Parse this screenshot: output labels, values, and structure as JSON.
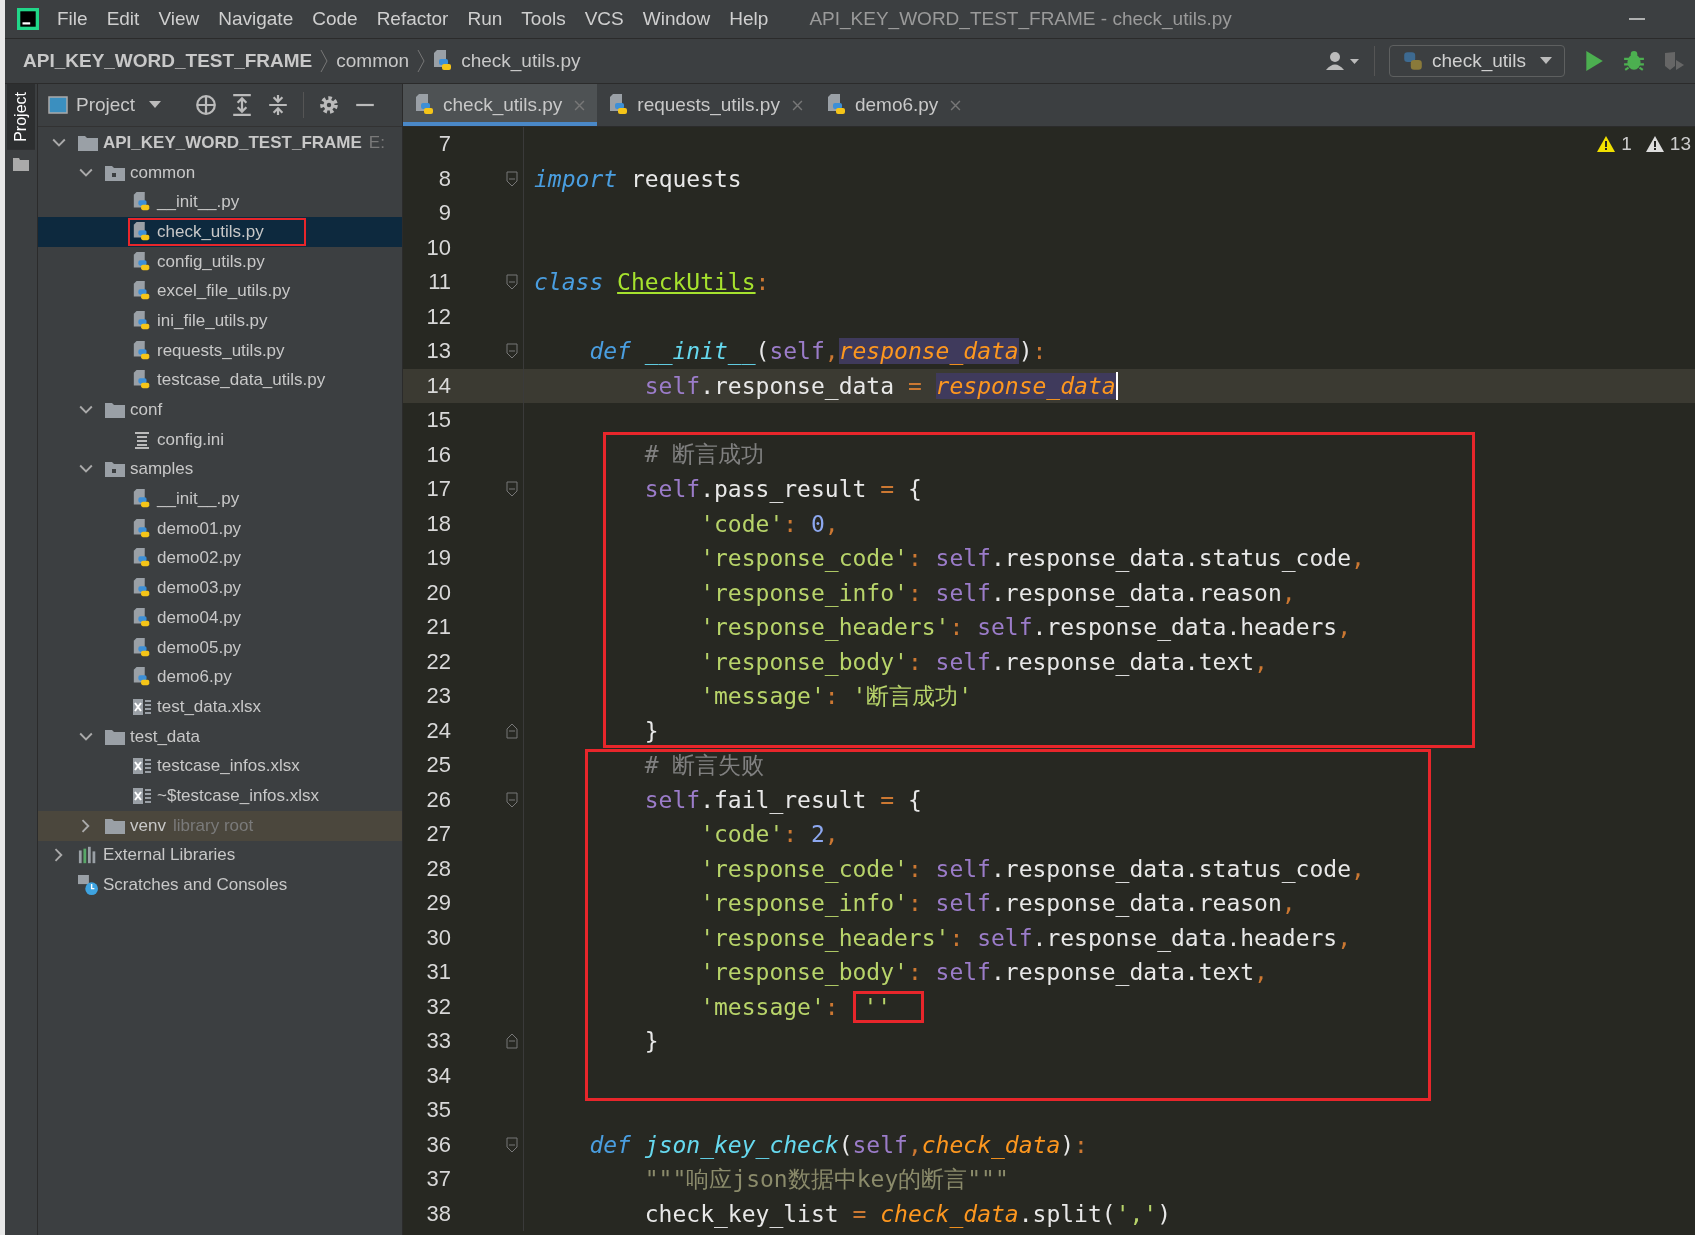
{
  "window": {
    "title": "API_KEY_WORD_TEST_FRAME - check_utils.py"
  },
  "menu": [
    "File",
    "Edit",
    "View",
    "Navigate",
    "Code",
    "Refactor",
    "Run",
    "Tools",
    "VCS",
    "Window",
    "Help"
  ],
  "breadcrumbs": [
    "API_KEY_WORD_TEST_FRAME",
    "common",
    "check_utils.py"
  ],
  "run_config": "check_utils",
  "side_strip": {
    "label": "Project"
  },
  "project_panel": {
    "title": "Project"
  },
  "tree": [
    {
      "label": "API_KEY_WORD_TEST_FRAME",
      "hint": "E:",
      "kind": "project",
      "expanded": true,
      "selected": false,
      "children": [
        {
          "label": "common",
          "kind": "package",
          "expanded": true,
          "selected": false,
          "children": [
            {
              "label": "__init__.py",
              "kind": "py",
              "selected": false
            },
            {
              "label": "check_utils.py",
              "kind": "py",
              "selected": true,
              "framed": true
            },
            {
              "label": "config_utils.py",
              "kind": "py",
              "selected": false
            },
            {
              "label": "excel_file_utils.py",
              "kind": "py",
              "selected": false
            },
            {
              "label": "ini_file_utils.py",
              "kind": "py",
              "selected": false
            },
            {
              "label": "requests_utils.py",
              "kind": "py",
              "selected": false
            },
            {
              "label": "testcase_data_utils.py",
              "kind": "py",
              "selected": false
            }
          ]
        },
        {
          "label": "conf",
          "kind": "folder",
          "expanded": true,
          "selected": false,
          "children": [
            {
              "label": "config.ini",
              "kind": "ini",
              "selected": false
            }
          ]
        },
        {
          "label": "samples",
          "kind": "package",
          "expanded": true,
          "selected": false,
          "children": [
            {
              "label": "__init__.py",
              "kind": "py",
              "selected": false
            },
            {
              "label": "demo01.py",
              "kind": "py",
              "selected": false
            },
            {
              "label": "demo02.py",
              "kind": "py",
              "selected": false
            },
            {
              "label": "demo03.py",
              "kind": "py",
              "selected": false
            },
            {
              "label": "demo04.py",
              "kind": "py",
              "selected": false
            },
            {
              "label": "demo05.py",
              "kind": "py",
              "selected": false
            },
            {
              "label": "demo6.py",
              "kind": "py",
              "selected": false
            },
            {
              "label": "test_data.xlsx",
              "kind": "xlsx",
              "selected": false
            }
          ]
        },
        {
          "label": "test_data",
          "kind": "folder",
          "expanded": true,
          "selected": false,
          "children": [
            {
              "label": "testcase_infos.xlsx",
              "kind": "xlsx",
              "selected": false
            },
            {
              "label": "~$testcase_infos.xlsx",
              "kind": "xlsx",
              "selected": false
            }
          ]
        },
        {
          "label": "venv",
          "hint": "library root",
          "kind": "folder",
          "expanded": false,
          "selected": false,
          "highlighted": true
        }
      ]
    },
    {
      "label": "External Libraries",
      "kind": "libs",
      "expanded": false,
      "selected": false
    },
    {
      "label": "Scratches and Consoles",
      "kind": "scratch",
      "selected": false
    }
  ],
  "tabs": [
    {
      "label": "check_utils.py",
      "selected": true
    },
    {
      "label": "requests_utils.py",
      "selected": false
    },
    {
      "label": "demo6.py",
      "selected": false
    }
  ],
  "inspections": [
    {
      "kind": "warning",
      "count": "1"
    },
    {
      "kind": "weak",
      "count": "13"
    }
  ],
  "code": {
    "sections": [
      {
        "lines": [
          {
            "n": "7"
          },
          {
            "n": "8",
            "fold_open": true,
            "tokens": [
              {
                "kind": "kw",
                "text": "import"
              },
              {
                "kind": "p",
                "text": " requests"
              }
            ]
          },
          {
            "n": "9"
          },
          {
            "n": "10"
          },
          {
            "n": "11",
            "fold_open": true,
            "tokens": [
              {
                "kind": "kw",
                "text": "class "
              },
              {
                "kind": "cls",
                "text": "CheckUtils"
              },
              {
                "kind": "op",
                "text": ":"
              }
            ]
          },
          {
            "n": "12"
          },
          {
            "n": "13",
            "fold_open": true,
            "tokens": [
              {
                "kind": "kw",
                "text": "    def "
              },
              {
                "kind": "fn",
                "text": "__init__"
              },
              {
                "kind": "p",
                "text": "("
              },
              {
                "kind": "self",
                "text": "self"
              },
              {
                "kind": "op",
                "text": ","
              },
              {
                "kind": "param_hl",
                "text": "response_data"
              },
              {
                "kind": "p",
                "text": ")"
              },
              {
                "kind": "op",
                "text": ":"
              }
            ]
          },
          {
            "n": "14",
            "current": true,
            "tokens": [
              {
                "kind": "self",
                "text": "        self"
              },
              {
                "kind": "p",
                "text": ".response_data "
              },
              {
                "kind": "op",
                "text": "= "
              },
              {
                "kind": "param_hl",
                "text": "response_data"
              }
            ]
          },
          {
            "n": "15"
          }
        ]
      },
      {
        "framed": true,
        "lines": [
          {
            "n": "16",
            "tokens": [
              {
                "kind": "cm",
                "text": "        # 断言成功"
              }
            ]
          },
          {
            "n": "17",
            "fold_open": true,
            "tokens": [
              {
                "kind": "self",
                "text": "        self"
              },
              {
                "kind": "p",
                "text": ".pass_result "
              },
              {
                "kind": "op",
                "text": "="
              },
              {
                "kind": "p",
                "text": " {"
              }
            ]
          },
          {
            "n": "18",
            "tokens": [
              {
                "kind": "str",
                "text": "            'code'"
              },
              {
                "kind": "op",
                "text": ":"
              },
              {
                "kind": "num",
                "text": " 0"
              },
              {
                "kind": "op",
                "text": ","
              }
            ]
          },
          {
            "n": "19",
            "tokens": [
              {
                "kind": "str",
                "text": "            'response_code'"
              },
              {
                "kind": "op",
                "text": ":"
              },
              {
                "kind": "self",
                "text": " self"
              },
              {
                "kind": "p",
                "text": ".response_data.status_code"
              },
              {
                "kind": "op",
                "text": ","
              }
            ]
          },
          {
            "n": "20",
            "tokens": [
              {
                "kind": "str",
                "text": "            'response_info'"
              },
              {
                "kind": "op",
                "text": ":"
              },
              {
                "kind": "self",
                "text": " self"
              },
              {
                "kind": "p",
                "text": ".response_data.reason"
              },
              {
                "kind": "op",
                "text": ","
              }
            ]
          },
          {
            "n": "21",
            "tokens": [
              {
                "kind": "str",
                "text": "            'response_headers'"
              },
              {
                "kind": "op",
                "text": ":"
              },
              {
                "kind": "self",
                "text": " self"
              },
              {
                "kind": "p",
                "text": ".response_data.headers"
              },
              {
                "kind": "op",
                "text": ","
              }
            ]
          },
          {
            "n": "22",
            "tokens": [
              {
                "kind": "str",
                "text": "            'response_body'"
              },
              {
                "kind": "op",
                "text": ":"
              },
              {
                "kind": "self",
                "text": " self"
              },
              {
                "kind": "p",
                "text": ".response_data.text"
              },
              {
                "kind": "op",
                "text": ","
              }
            ]
          },
          {
            "n": "23",
            "tokens": [
              {
                "kind": "str",
                "text": "            'message'"
              },
              {
                "kind": "op",
                "text": ":"
              },
              {
                "kind": "str",
                "text": " '断言成功'"
              }
            ]
          },
          {
            "n": "24",
            "fold_close": true,
            "tokens": [
              {
                "kind": "p",
                "text": "        }"
              }
            ]
          }
        ]
      },
      {
        "framed": true,
        "lines": [
          {
            "n": "25",
            "tokens": [
              {
                "kind": "cm",
                "text": "        # 断言失败"
              }
            ]
          },
          {
            "n": "26",
            "fold_open": true,
            "tokens": [
              {
                "kind": "self",
                "text": "        self"
              },
              {
                "kind": "p",
                "text": ".fail_result "
              },
              {
                "kind": "op",
                "text": "="
              },
              {
                "kind": "p",
                "text": " {"
              }
            ]
          },
          {
            "n": "27",
            "tokens": [
              {
                "kind": "str",
                "text": "            'code'"
              },
              {
                "kind": "op",
                "text": ":"
              },
              {
                "kind": "num",
                "text": " 2"
              },
              {
                "kind": "op",
                "text": ","
              }
            ]
          },
          {
            "n": "28",
            "tokens": [
              {
                "kind": "str",
                "text": "            'response_code'"
              },
              {
                "kind": "op",
                "text": ":"
              },
              {
                "kind": "self",
                "text": " self"
              },
              {
                "kind": "p",
                "text": ".response_data.status_code"
              },
              {
                "kind": "op",
                "text": ","
              }
            ]
          },
          {
            "n": "29",
            "tokens": [
              {
                "kind": "str",
                "text": "            'response_info'"
              },
              {
                "kind": "op",
                "text": ":"
              },
              {
                "kind": "self",
                "text": " self"
              },
              {
                "kind": "p",
                "text": ".response_data.reason"
              },
              {
                "kind": "op",
                "text": ","
              }
            ]
          },
          {
            "n": "30",
            "tokens": [
              {
                "kind": "str",
                "text": "            'response_headers'"
              },
              {
                "kind": "op",
                "text": ":"
              },
              {
                "kind": "self",
                "text": " self"
              },
              {
                "kind": "p",
                "text": ".response_data.headers"
              },
              {
                "kind": "op",
                "text": ","
              }
            ]
          },
          {
            "n": "31",
            "tokens": [
              {
                "kind": "str",
                "text": "            'response_body'"
              },
              {
                "kind": "op",
                "text": ":"
              },
              {
                "kind": "self",
                "text": " self"
              },
              {
                "kind": "p",
                "text": ".response_data.text"
              },
              {
                "kind": "op",
                "text": ","
              }
            ]
          },
          {
            "n": "32",
            "tokens": [
              {
                "kind": "str",
                "text": "            'message'"
              },
              {
                "kind": "op",
                "text": ": "
              },
              {
                "kind": "strbox",
                "text": "''"
              }
            ]
          },
          {
            "n": "33",
            "fold_close": true,
            "tokens": [
              {
                "kind": "p",
                "text": "        }"
              }
            ]
          },
          {
            "n": "34"
          }
        ]
      },
      {
        "lines": [
          {
            "n": "35"
          },
          {
            "n": "36",
            "fold_open": true,
            "tokens": [
              {
                "kind": "kw",
                "text": "    def "
              },
              {
                "kind": "fn",
                "text": "json_key_check"
              },
              {
                "kind": "p",
                "text": "("
              },
              {
                "kind": "self",
                "text": "self"
              },
              {
                "kind": "op",
                "text": ","
              },
              {
                "kind": "param",
                "text": "check_data"
              },
              {
                "kind": "p",
                "text": ")"
              },
              {
                "kind": "op",
                "text": ":"
              }
            ]
          },
          {
            "n": "37",
            "tokens": [
              {
                "kind": "doc",
                "text": "        \"\"\"响应json数据中key的断言\"\"\""
              }
            ]
          },
          {
            "n": "38",
            "tokens": [
              {
                "kind": "p",
                "text": "        check_key_list "
              },
              {
                "kind": "op",
                "text": "= "
              },
              {
                "kind": "param",
                "text": "check_data"
              },
              {
                "kind": "p",
                "text": ".split("
              },
              {
                "kind": "str",
                "text": "','"
              },
              {
                "kind": "p",
                "text": ")"
              }
            ]
          }
        ]
      }
    ]
  }
}
